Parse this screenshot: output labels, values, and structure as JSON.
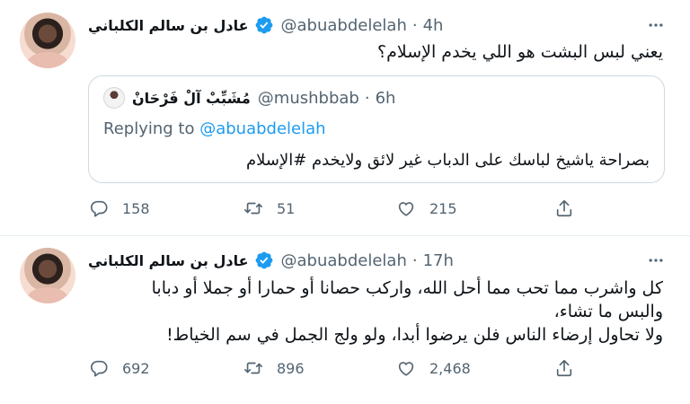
{
  "tweets": [
    {
      "name": "عادل بن سالم الكلباني",
      "handle": "@abuabdelelah",
      "separator": "·",
      "time": "4h",
      "text": "يعني لبس البشت هو اللي يخدم الإسلام؟",
      "quote": {
        "name": "مُشَبِّبْ آلْ فَرْحَانْ",
        "handle": "@mushbbab",
        "separator": "·",
        "time": "6h",
        "replying_label": "Replying to",
        "replying_to": "@abuabdelelah",
        "text": "بصراحة ياشيخ لباسك على الدباب غير لائق ولايخدم #الإسلام"
      },
      "actions": {
        "replies": "158",
        "retweets": "51",
        "likes": "215"
      }
    },
    {
      "name": "عادل بن سالم الكلباني",
      "handle": "@abuabdelelah",
      "separator": "·",
      "time": "17h",
      "text": "كل واشرب مما تحب مما أحل الله، واركب حصانا أو حمارا أو جملا أو دبابا\nوالبس ما تشاء،\nولا تحاول إرضاء الناس فلن يرضوا أبدا، ولو ولج الجمل في سم الخياط!",
      "actions": {
        "replies": "692",
        "retweets": "896",
        "likes": "2,468"
      }
    }
  ],
  "icons": {
    "verified": "verified-badge-icon",
    "more": "more-options-icon",
    "reply": "reply-icon",
    "retweet": "retweet-icon",
    "like": "like-icon",
    "share": "share-icon"
  },
  "colors": {
    "verified": "#1d9bf0",
    "mention": "#1d9bf0",
    "muted": "#536471",
    "border": "#cfd9de"
  }
}
